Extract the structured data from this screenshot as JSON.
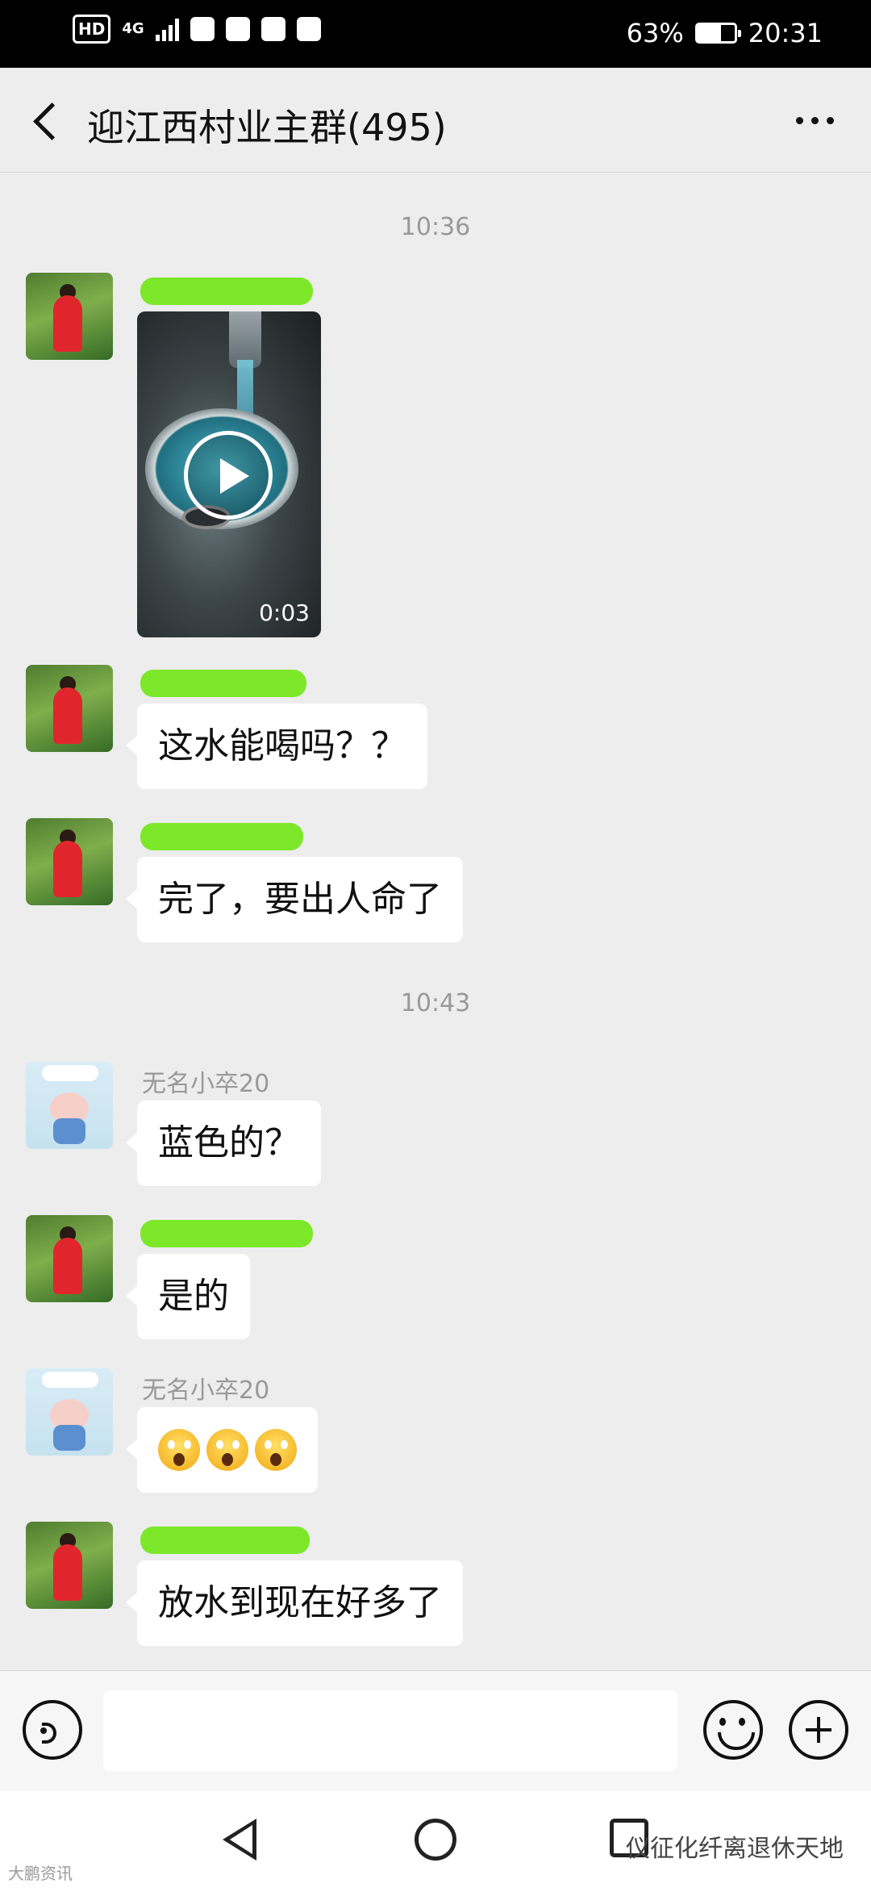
{
  "status_bar": {
    "hd": "HD",
    "network": "4G",
    "battery_percent": "63%",
    "battery_level": 0.63,
    "time": "20:31"
  },
  "header": {
    "title": "迎江西村业主群(495)"
  },
  "messages": [
    {
      "time": "10:36"
    },
    {
      "video_duration": "0:03"
    },
    {
      "text": "这水能喝吗？？"
    },
    {
      "text": "完了，要出人命了"
    },
    {
      "time": "10:43"
    },
    {
      "sender": "无名小卒20",
      "text": "蓝色的？"
    },
    {
      "text": "是的"
    },
    {
      "sender": "无名小卒20",
      "emojis": [
        "scream-emoji",
        "scream-emoji",
        "scream-emoji"
      ]
    },
    {
      "text": "放水到现在好多了"
    }
  ],
  "watermarks": {
    "left": "大鹏资讯",
    "right": "仪征化纤离退休天地"
  },
  "colors": {
    "background": "#ededed",
    "bubble": "#ffffff",
    "redaction": "#7de82a"
  }
}
